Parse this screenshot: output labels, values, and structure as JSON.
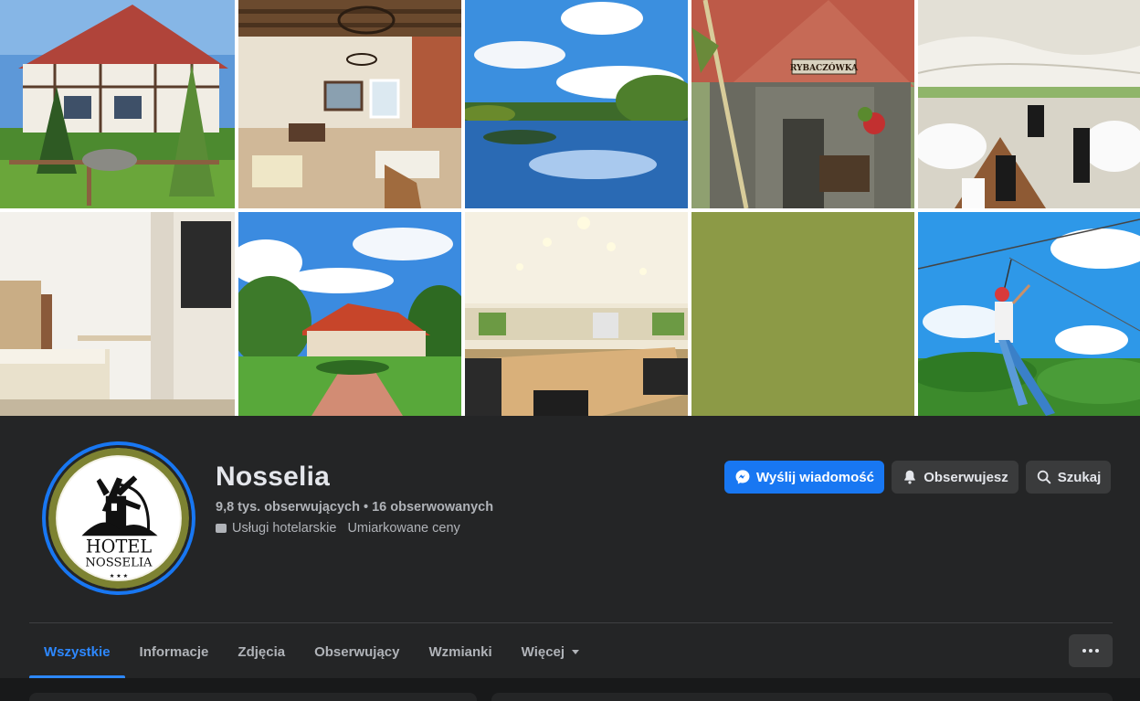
{
  "page": {
    "name": "Nosselia",
    "followers": "9,8 tys. obserwujących",
    "separator": " • ",
    "following": "16 obserwowanych",
    "category": "Usługi hotelarskie",
    "price_range": "Umiarkowane ceny"
  },
  "avatar": {
    "line1": "HOTEL",
    "line2": "NOSSELIA",
    "stars": "★ ★ ★"
  },
  "cover": {
    "sign_text": "RYBACZÓWKA"
  },
  "actions": {
    "message_label": "Wyślij wiadomość",
    "follow_label": "Obserwujesz",
    "search_label": "Szukaj"
  },
  "tabs": [
    {
      "label": "Wszystkie"
    },
    {
      "label": "Informacje"
    },
    {
      "label": "Zdjęcia"
    },
    {
      "label": "Obserwujący"
    },
    {
      "label": "Wzmianki"
    },
    {
      "label": "Więcej"
    }
  ],
  "colors": {
    "accent": "#1877f2",
    "active_tab": "#2d88ff",
    "panel_bg": "#242526",
    "page_bg": "#18191a",
    "olive_tile": "#8c9a46"
  },
  "icons": {
    "message": "messenger-icon",
    "follow": "bell-icon",
    "search": "search-icon",
    "more": "more-dots-icon",
    "dropdown": "caret-down-icon",
    "category": "category-icon"
  }
}
